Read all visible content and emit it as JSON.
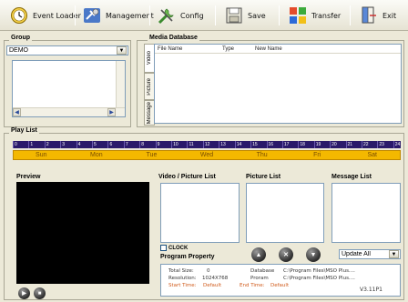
{
  "toolbar": {
    "items": [
      {
        "label": "Event Loader",
        "icon": "clock-icon"
      },
      {
        "label": "Management",
        "icon": "tools-icon"
      },
      {
        "label": "Config",
        "icon": "wrench-icon"
      },
      {
        "label": "Save",
        "icon": "save-icon"
      },
      {
        "label": "Transfer",
        "icon": "transfer-icon"
      },
      {
        "label": "Exit",
        "icon": "exit-icon"
      }
    ]
  },
  "group": {
    "title": "Group",
    "selected": "DEMO"
  },
  "media_database": {
    "title": "Media Database",
    "tabs": [
      "Video",
      "Picture",
      "Message"
    ],
    "columns": [
      "File Name",
      "Type",
      "New Name"
    ]
  },
  "play_list": {
    "title": "Play List",
    "hours": [
      "0",
      "1",
      "2",
      "3",
      "4",
      "5",
      "6",
      "7",
      "8",
      "9",
      "10",
      "11",
      "12",
      "13",
      "14",
      "15",
      "16",
      "17",
      "18",
      "19",
      "20",
      "21",
      "22",
      "23",
      "24"
    ],
    "days": [
      "Sun",
      "Mon",
      "Tue",
      "Wed",
      "Thu",
      "Fri",
      "Sat"
    ]
  },
  "preview": {
    "title": "Preview"
  },
  "video_picture_list": {
    "title": "Video / Picture List"
  },
  "picture_list": {
    "title": "Picture List"
  },
  "message_list": {
    "title": "Message List"
  },
  "clock": {
    "label": "CLOCK"
  },
  "update": {
    "selected": "Update All"
  },
  "program_property": {
    "title": "Program Property",
    "total_size_label": "Total Size:",
    "total_size_value": "0",
    "resolution_label": "Resolution:",
    "resolution_value": "1024X768",
    "start_time_label": "Start Time:",
    "start_time_value": "Default",
    "end_time_label": "End Time:",
    "end_time_value": "Default",
    "database_label": "Database",
    "database_value": "C:\\Program Files\\MSO  Plus....",
    "program_label": "Proram",
    "program_value": "C:\\Program Files\\MSO  Plus....",
    "version": "V3.11P1"
  },
  "colors": {
    "ruler": "#2a1a6a",
    "days_bar": "#f4b800",
    "accent": "#7f9db9"
  }
}
